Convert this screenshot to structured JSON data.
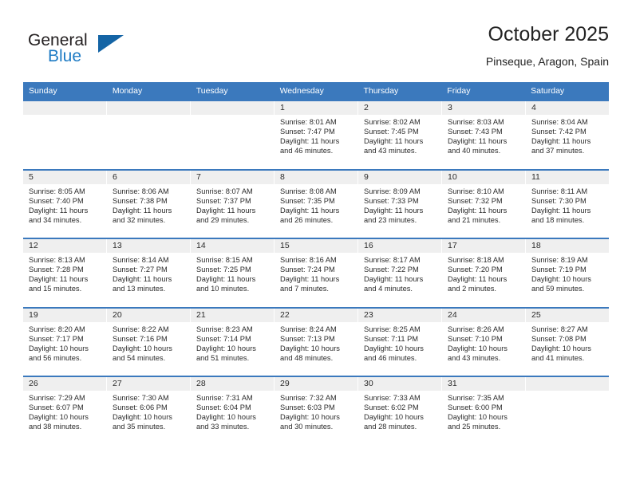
{
  "logo": {
    "word_top": "General",
    "word_bottom": "Blue",
    "triangle_color": "#1464a5",
    "blue_color": "#1e7bc4"
  },
  "header": {
    "title": "October 2025",
    "location": "Pinseque, Aragon, Spain"
  },
  "theme": {
    "header_blue": "#3b79bd",
    "cell_head_gray": "#efefef",
    "text": "#2b2b2b"
  },
  "weekday_headers": [
    "Sunday",
    "Monday",
    "Tuesday",
    "Wednesday",
    "Thursday",
    "Friday",
    "Saturday"
  ],
  "weeks": [
    [
      {
        "day": "",
        "lines": []
      },
      {
        "day": "",
        "lines": []
      },
      {
        "day": "",
        "lines": []
      },
      {
        "day": "1",
        "lines": [
          "Sunrise: 8:01 AM",
          "Sunset: 7:47 PM",
          "Daylight: 11 hours",
          "and 46 minutes."
        ]
      },
      {
        "day": "2",
        "lines": [
          "Sunrise: 8:02 AM",
          "Sunset: 7:45 PM",
          "Daylight: 11 hours",
          "and 43 minutes."
        ]
      },
      {
        "day": "3",
        "lines": [
          "Sunrise: 8:03 AM",
          "Sunset: 7:43 PM",
          "Daylight: 11 hours",
          "and 40 minutes."
        ]
      },
      {
        "day": "4",
        "lines": [
          "Sunrise: 8:04 AM",
          "Sunset: 7:42 PM",
          "Daylight: 11 hours",
          "and 37 minutes."
        ]
      }
    ],
    [
      {
        "day": "5",
        "lines": [
          "Sunrise: 8:05 AM",
          "Sunset: 7:40 PM",
          "Daylight: 11 hours",
          "and 34 minutes."
        ]
      },
      {
        "day": "6",
        "lines": [
          "Sunrise: 8:06 AM",
          "Sunset: 7:38 PM",
          "Daylight: 11 hours",
          "and 32 minutes."
        ]
      },
      {
        "day": "7",
        "lines": [
          "Sunrise: 8:07 AM",
          "Sunset: 7:37 PM",
          "Daylight: 11 hours",
          "and 29 minutes."
        ]
      },
      {
        "day": "8",
        "lines": [
          "Sunrise: 8:08 AM",
          "Sunset: 7:35 PM",
          "Daylight: 11 hours",
          "and 26 minutes."
        ]
      },
      {
        "day": "9",
        "lines": [
          "Sunrise: 8:09 AM",
          "Sunset: 7:33 PM",
          "Daylight: 11 hours",
          "and 23 minutes."
        ]
      },
      {
        "day": "10",
        "lines": [
          "Sunrise: 8:10 AM",
          "Sunset: 7:32 PM",
          "Daylight: 11 hours",
          "and 21 minutes."
        ]
      },
      {
        "day": "11",
        "lines": [
          "Sunrise: 8:11 AM",
          "Sunset: 7:30 PM",
          "Daylight: 11 hours",
          "and 18 minutes."
        ]
      }
    ],
    [
      {
        "day": "12",
        "lines": [
          "Sunrise: 8:13 AM",
          "Sunset: 7:28 PM",
          "Daylight: 11 hours",
          "and 15 minutes."
        ]
      },
      {
        "day": "13",
        "lines": [
          "Sunrise: 8:14 AM",
          "Sunset: 7:27 PM",
          "Daylight: 11 hours",
          "and 13 minutes."
        ]
      },
      {
        "day": "14",
        "lines": [
          "Sunrise: 8:15 AM",
          "Sunset: 7:25 PM",
          "Daylight: 11 hours",
          "and 10 minutes."
        ]
      },
      {
        "day": "15",
        "lines": [
          "Sunrise: 8:16 AM",
          "Sunset: 7:24 PM",
          "Daylight: 11 hours",
          "and 7 minutes."
        ]
      },
      {
        "day": "16",
        "lines": [
          "Sunrise: 8:17 AM",
          "Sunset: 7:22 PM",
          "Daylight: 11 hours",
          "and 4 minutes."
        ]
      },
      {
        "day": "17",
        "lines": [
          "Sunrise: 8:18 AM",
          "Sunset: 7:20 PM",
          "Daylight: 11 hours",
          "and 2 minutes."
        ]
      },
      {
        "day": "18",
        "lines": [
          "Sunrise: 8:19 AM",
          "Sunset: 7:19 PM",
          "Daylight: 10 hours",
          "and 59 minutes."
        ]
      }
    ],
    [
      {
        "day": "19",
        "lines": [
          "Sunrise: 8:20 AM",
          "Sunset: 7:17 PM",
          "Daylight: 10 hours",
          "and 56 minutes."
        ]
      },
      {
        "day": "20",
        "lines": [
          "Sunrise: 8:22 AM",
          "Sunset: 7:16 PM",
          "Daylight: 10 hours",
          "and 54 minutes."
        ]
      },
      {
        "day": "21",
        "lines": [
          "Sunrise: 8:23 AM",
          "Sunset: 7:14 PM",
          "Daylight: 10 hours",
          "and 51 minutes."
        ]
      },
      {
        "day": "22",
        "lines": [
          "Sunrise: 8:24 AM",
          "Sunset: 7:13 PM",
          "Daylight: 10 hours",
          "and 48 minutes."
        ]
      },
      {
        "day": "23",
        "lines": [
          "Sunrise: 8:25 AM",
          "Sunset: 7:11 PM",
          "Daylight: 10 hours",
          "and 46 minutes."
        ]
      },
      {
        "day": "24",
        "lines": [
          "Sunrise: 8:26 AM",
          "Sunset: 7:10 PM",
          "Daylight: 10 hours",
          "and 43 minutes."
        ]
      },
      {
        "day": "25",
        "lines": [
          "Sunrise: 8:27 AM",
          "Sunset: 7:08 PM",
          "Daylight: 10 hours",
          "and 41 minutes."
        ]
      }
    ],
    [
      {
        "day": "26",
        "lines": [
          "Sunrise: 7:29 AM",
          "Sunset: 6:07 PM",
          "Daylight: 10 hours",
          "and 38 minutes."
        ]
      },
      {
        "day": "27",
        "lines": [
          "Sunrise: 7:30 AM",
          "Sunset: 6:06 PM",
          "Daylight: 10 hours",
          "and 35 minutes."
        ]
      },
      {
        "day": "28",
        "lines": [
          "Sunrise: 7:31 AM",
          "Sunset: 6:04 PM",
          "Daylight: 10 hours",
          "and 33 minutes."
        ]
      },
      {
        "day": "29",
        "lines": [
          "Sunrise: 7:32 AM",
          "Sunset: 6:03 PM",
          "Daylight: 10 hours",
          "and 30 minutes."
        ]
      },
      {
        "day": "30",
        "lines": [
          "Sunrise: 7:33 AM",
          "Sunset: 6:02 PM",
          "Daylight: 10 hours",
          "and 28 minutes."
        ]
      },
      {
        "day": "31",
        "lines": [
          "Sunrise: 7:35 AM",
          "Sunset: 6:00 PM",
          "Daylight: 10 hours",
          "and 25 minutes."
        ]
      },
      {
        "day": "",
        "lines": []
      }
    ]
  ]
}
